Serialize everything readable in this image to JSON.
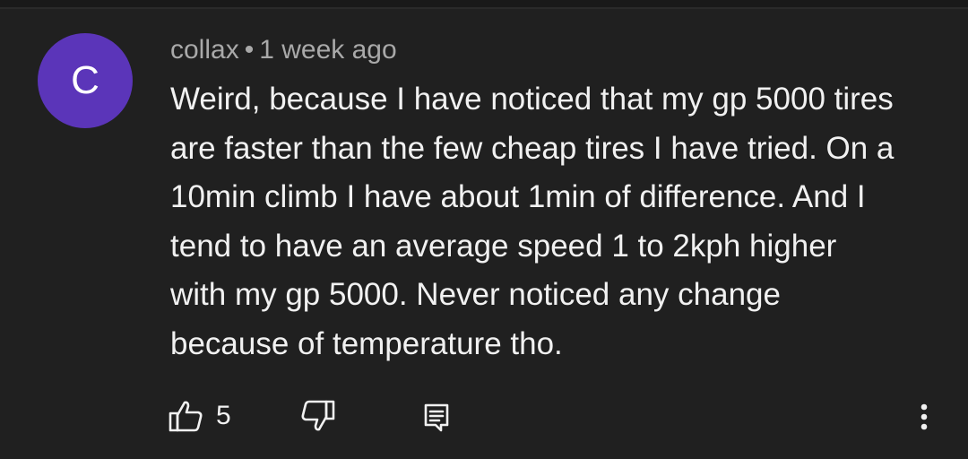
{
  "comment": {
    "avatar_letter": "C",
    "avatar_color": "#5b35b9",
    "author": "collax",
    "separator": "•",
    "timestamp": "1 week ago",
    "text": "Weird, because I have noticed that my gp 5000 tires\nare faster than the few cheap tires I have tried. On a\n10min climb I have about 1min of difference. And I\ntend to have an average speed 1 to 2kph higher\nwith my gp 5000. Never noticed any change\nbecause of temperature tho."
  },
  "actions": {
    "like_count": "5",
    "like_icon": "thumbs-up-icon",
    "dislike_icon": "thumbs-down-icon",
    "reply_icon": "comment-reply-icon",
    "more_icon": "more-vertical-icon"
  }
}
